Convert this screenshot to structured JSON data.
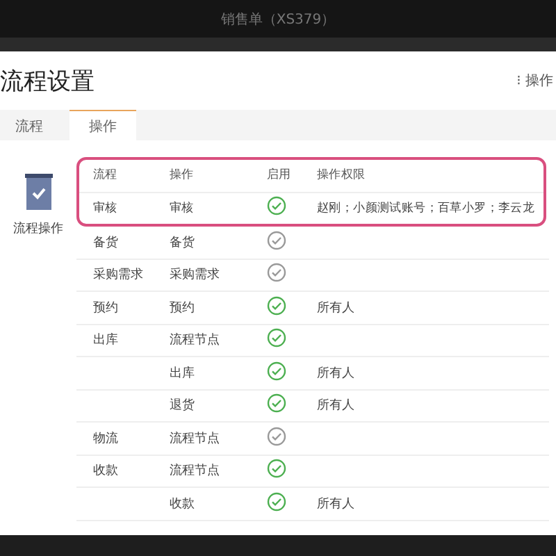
{
  "window": {
    "title": "销售单（XS379）"
  },
  "dialog": {
    "title": "流程设置",
    "menu": {
      "icon": "⁝",
      "label": "操作"
    },
    "tabs": [
      {
        "label": "流程",
        "selected": false
      },
      {
        "label": "操作",
        "selected": true
      }
    ],
    "sidebar": {
      "label": "流程操作"
    },
    "table": {
      "columns": [
        "流程",
        "操作",
        "启用",
        "操作权限"
      ],
      "rows": [
        {
          "flow": "审核",
          "action": "审核",
          "enabled": true,
          "permission": "赵刚；小颜测试账号；百草小罗；李云龙"
        },
        {
          "flow": "备货",
          "action": "备货",
          "enabled": false
        },
        {
          "flow": "采购需求",
          "action": "采购需求",
          "enabled": false
        },
        {
          "flow": "预约",
          "action": "预约",
          "enabled": true,
          "permission": "所有人"
        },
        {
          "flow": "出库",
          "action": "流程节点",
          "enabled": true
        },
        {
          "action": "出库",
          "enabled": true,
          "permission": "所有人"
        },
        {
          "action": "退货",
          "enabled": true,
          "permission": "所有人"
        },
        {
          "flow": "物流",
          "action": "流程节点",
          "enabled": false
        },
        {
          "flow": "收款",
          "action": "流程节点",
          "enabled": true
        },
        {
          "action": "收款",
          "enabled": true,
          "permission": "所有人"
        }
      ]
    }
  }
}
